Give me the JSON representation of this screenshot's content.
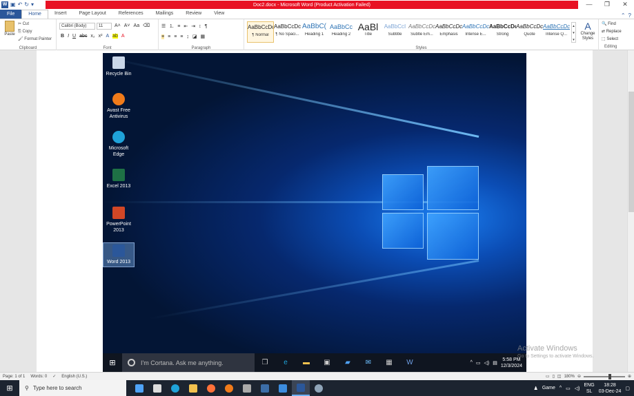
{
  "title_bar": {
    "title": "Doc2.docx - Microsoft Word (Product Activation Failed)",
    "window_controls": [
      "—",
      "❐",
      "✕"
    ]
  },
  "ribbon_tabs": [
    "File",
    "Home",
    "Insert",
    "Page Layout",
    "References",
    "Mailings",
    "Review",
    "View"
  ],
  "active_tab": "Home",
  "clipboard": {
    "paste": "Paste",
    "cut": "Cut",
    "copy": "Copy",
    "format_painter": "Format Painter",
    "label": "Clipboard"
  },
  "font": {
    "name": "Calibri (Body)",
    "size": "11",
    "label": "Font"
  },
  "paragraph": {
    "label": "Paragraph"
  },
  "styles": {
    "label": "Styles",
    "items": [
      {
        "preview": "AaBbCcDc",
        "name": "¶ Normal"
      },
      {
        "preview": "AaBbCcDc",
        "name": "¶ No Spaci..."
      },
      {
        "preview": "AaBbC(",
        "name": "Heading 1"
      },
      {
        "preview": "AaBbCc",
        "name": "Heading 2"
      },
      {
        "preview": "AaBl",
        "name": "Title"
      },
      {
        "preview": "AaBbCcI",
        "name": "Subtitle"
      },
      {
        "preview": "AaBbCcDc",
        "name": "Subtle Em..."
      },
      {
        "preview": "AaBbCcDc",
        "name": "Emphasis"
      },
      {
        "preview": "AaBbCcDc",
        "name": "Intense E..."
      },
      {
        "preview": "AaBbCcDc",
        "name": "Strong"
      },
      {
        "preview": "AaBbCcDc",
        "name": "Quote"
      },
      {
        "preview": "AaBbCcDc",
        "name": "Intense Q..."
      }
    ],
    "change_styles": "Change Styles"
  },
  "editing": {
    "find": "Find",
    "replace": "Replace",
    "select": "Select",
    "label": "Editing"
  },
  "desktop_icons": [
    {
      "label": "Recycle Bin",
      "color": "#c9d6e8"
    },
    {
      "label": "Avast Free Antivirus",
      "color": "#f07b1a"
    },
    {
      "label": "Microsoft Edge",
      "color": "#1fa2d8"
    },
    {
      "label": "Excel 2013",
      "color": "#1e7145"
    },
    {
      "label": "PowerPoint 2013",
      "color": "#d24726"
    },
    {
      "label": "Word 2013",
      "color": "#2b579a"
    }
  ],
  "inner_taskbar": {
    "cortana": "I'm Cortana. Ask me anything.",
    "time": "5:58 PM",
    "date": "12/3/2024"
  },
  "activate": {
    "title": "Activate Windows",
    "subtitle": "Go to Settings to activate Windows."
  },
  "status_bar": {
    "page": "Page: 1 of 1",
    "words": "Words: 0",
    "language": "English (U.S.)",
    "zoom": "180%"
  },
  "taskbar": {
    "search": "Type here to search",
    "game": "Game",
    "lang": "ENG",
    "lang2": "SL",
    "time": "18:28",
    "date": "03-Dec-24"
  },
  "colors": {
    "word_blue": "#2b579a",
    "title_red": "#e81123"
  }
}
